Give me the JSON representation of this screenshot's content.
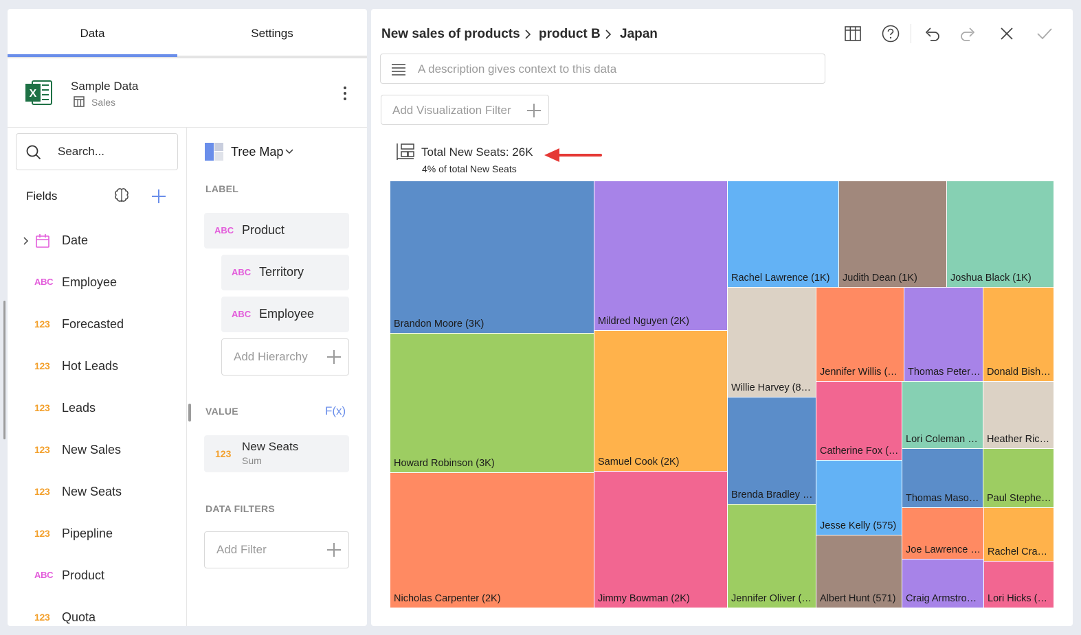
{
  "tabs": {
    "data": "Data",
    "settings": "Settings"
  },
  "source": {
    "name": "Sample Data",
    "sheet": "Sales"
  },
  "search": {
    "placeholder": "Search..."
  },
  "fields": {
    "title": "Fields",
    "items": [
      {
        "type": "date",
        "label": "Date"
      },
      {
        "type": "ABC",
        "label": "Employee"
      },
      {
        "type": "123",
        "label": "Forecasted"
      },
      {
        "type": "123",
        "label": "Hot Leads"
      },
      {
        "type": "123",
        "label": "Leads"
      },
      {
        "type": "123",
        "label": "New Sales"
      },
      {
        "type": "123",
        "label": "New Seats"
      },
      {
        "type": "123",
        "label": "Pipepline"
      },
      {
        "type": "ABC",
        "label": "Product"
      },
      {
        "type": "123",
        "label": "Quota"
      }
    ]
  },
  "viz": {
    "type_label": "Tree Map",
    "label_section": "LABEL",
    "labels": [
      {
        "type": "ABC",
        "label": "Product"
      },
      {
        "type": "ABC",
        "label": "Territory"
      },
      {
        "type": "ABC",
        "label": "Employee"
      }
    ],
    "add_hierarchy": "Add Hierarchy",
    "value_section": "VALUE",
    "fx": "F(x)",
    "value": {
      "type": "123",
      "label": "New Seats",
      "agg": "Sum"
    },
    "filters_section": "DATA FILTERS",
    "add_filter": "Add Filter"
  },
  "breadcrumb": [
    "New sales of products",
    "product B",
    "Japan"
  ],
  "description_placeholder": "A description gives context to this data",
  "add_viz_filter": "Add Visualization Filter",
  "summary": {
    "total": "Total New Seats: 26K",
    "pct": "4% of total New Seats"
  },
  "colors": {
    "accent": "#6a8eea",
    "abc": "#e35ddb",
    "num": "#f3a02c"
  },
  "treemap": [
    {
      "label": "Brandon Moore (3K)",
      "color": "#5b8dc9"
    },
    {
      "label": "Howard Robinson (3K)",
      "color": "#9dcd62"
    },
    {
      "label": "Nicholas Carpenter (2K)",
      "color": "#ff8a62"
    },
    {
      "label": "Mildred Nguyen (2K)",
      "color": "#a783e8"
    },
    {
      "label": "Samuel Cook (2K)",
      "color": "#ffb24b"
    },
    {
      "label": "Jimmy Bowman (2K)",
      "color": "#f26691"
    },
    {
      "label": "Rachel Lawrence (1K)",
      "color": "#63b2f5"
    },
    {
      "label": "Judith Dean (1K)",
      "color": "#a1887c"
    },
    {
      "label": "Joshua Black (1K)",
      "color": "#86d0b3"
    },
    {
      "label": "Willie Harvey (86…",
      "color": "#dcd2c5"
    },
    {
      "label": "Brenda Bradley (…",
      "color": "#5b8dc9"
    },
    {
      "label": "Jennifer Oliver (…",
      "color": "#9dcd62"
    },
    {
      "label": "Jennifer Willis (7…",
      "color": "#ff8a62"
    },
    {
      "label": "Thomas Peter…",
      "color": "#a783e8"
    },
    {
      "label": "Donald Bisho…",
      "color": "#ffb24b"
    },
    {
      "label": "Catherine Fox (…",
      "color": "#f26691"
    },
    {
      "label": "Lori Coleman (…",
      "color": "#86d0b3"
    },
    {
      "label": "Heather Rice…",
      "color": "#dcd2c5"
    },
    {
      "label": "Jesse Kelly (575)",
      "color": "#63b2f5"
    },
    {
      "label": "Thomas Maso…",
      "color": "#5b8dc9"
    },
    {
      "label": "Paul Stephen…",
      "color": "#9dcd62"
    },
    {
      "label": "Albert Hunt (571)",
      "color": "#a1887c"
    },
    {
      "label": "Joe Lawrence (…",
      "color": "#ff8a62"
    },
    {
      "label": "Rachel Craw…",
      "color": "#ffb24b"
    },
    {
      "label": "Craig Armstron…",
      "color": "#a783e8"
    },
    {
      "label": "Lori Hicks (3…",
      "color": "#f26691"
    }
  ]
}
